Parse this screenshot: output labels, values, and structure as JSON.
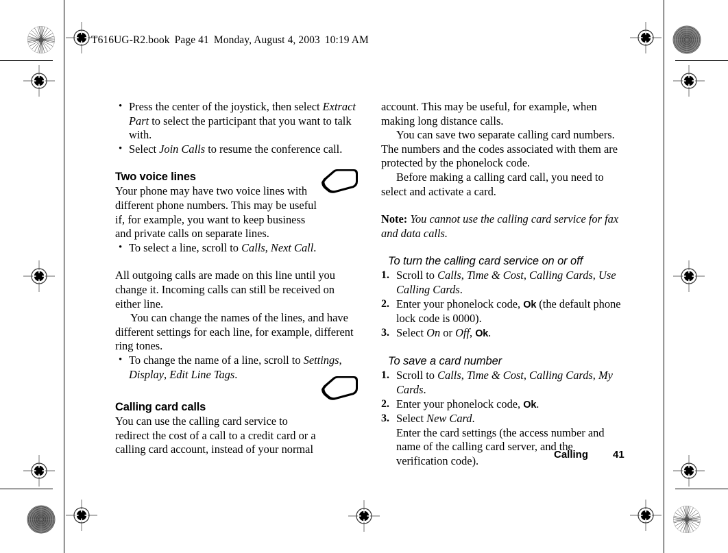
{
  "document": {
    "file_header": "T616UG-R2.book  Page 41  Monday, August 4, 2003  10:19 AM",
    "file_header_parts": {
      "filename": "T616UG-R2.book",
      "page_label": "Page 41",
      "date": "Monday, August 4, 2003",
      "time": "10:19 AM"
    },
    "footer": {
      "chapter": "Calling",
      "page_number": "41"
    }
  },
  "left_column": {
    "intro_bullets": [
      {
        "segments": [
          {
            "text": "Press the center of the joystick, then select ",
            "style": "roman"
          },
          {
            "text": "Extract Part",
            "style": "italic"
          },
          {
            "text": " to select the participant that you want to talk with.",
            "style": "roman"
          }
        ]
      },
      {
        "segments": [
          {
            "text": "Select ",
            "style": "roman"
          },
          {
            "text": "Join Calls",
            "style": "italic"
          },
          {
            "text": " to resume the conference call.",
            "style": "roman"
          }
        ]
      }
    ],
    "section_two_voice_lines": {
      "heading": "Two voice lines",
      "paragraph": "Your phone may have two voice lines with different phone numbers. This may be useful if, for example, you want to keep business and private calls on separate lines.",
      "bullet": {
        "segments": [
          {
            "text": "To select a line, scroll to ",
            "style": "roman"
          },
          {
            "text": "Calls",
            "style": "italic"
          },
          {
            "text": ", ",
            "style": "roman"
          },
          {
            "text": "Next Call",
            "style": "italic"
          },
          {
            "text": ".",
            "style": "roman"
          }
        ]
      },
      "paragraph_2": "All outgoing calls are made on this line until you change it. Incoming calls can still be received on either line.",
      "paragraph_3": "You can change the names of the lines, and have different settings for each line, for example, different ring tones.",
      "bullet_2": {
        "segments": [
          {
            "text": "To change the name of a line, scroll to ",
            "style": "roman"
          },
          {
            "text": "Settings",
            "style": "italic"
          },
          {
            "text": ", ",
            "style": "roman"
          },
          {
            "text": "Display",
            "style": "italic"
          },
          {
            "text": ", ",
            "style": "roman"
          },
          {
            "text": "Edit Line Tags",
            "style": "italic"
          },
          {
            "text": ".",
            "style": "roman"
          }
        ]
      }
    },
    "section_calling_card_calls": {
      "heading": "Calling card calls",
      "paragraph": "You can use the calling card service to redirect the cost of a call to a credit card or a calling card account, instead of your normal"
    }
  },
  "right_column": {
    "paragraph_continued": "account. This may be useful, for example, when making long distance calls.",
    "paragraph_2": "You can save two separate calling card numbers. The numbers and the codes associated with them are protected by the phonelock code.",
    "paragraph_3": "Before making a calling card call, you need to select and activate a card.",
    "note": {
      "label": "Note:",
      "text": "You cannot use the calling card service for fax and data calls."
    },
    "procedure_on_off": {
      "heading": "To turn the calling card service on or off",
      "steps": [
        {
          "number": "1.",
          "segments": [
            {
              "text": "Scroll to ",
              "style": "roman"
            },
            {
              "text": "Calls",
              "style": "italic"
            },
            {
              "text": ", ",
              "style": "roman"
            },
            {
              "text": "Time & Cost",
              "style": "italic"
            },
            {
              "text": ", ",
              "style": "roman"
            },
            {
              "text": "Calling Cards",
              "style": "italic"
            },
            {
              "text": ", ",
              "style": "roman"
            },
            {
              "text": "Use Calling Cards",
              "style": "italic"
            },
            {
              "text": ".",
              "style": "roman"
            }
          ]
        },
        {
          "number": "2.",
          "segments": [
            {
              "text": "Enter your phonelock code, ",
              "style": "roman"
            },
            {
              "text": "Ok",
              "style": "key"
            },
            {
              "text": " (the default phone lock code is 0000).",
              "style": "roman"
            }
          ]
        },
        {
          "number": "3.",
          "segments": [
            {
              "text": "Select ",
              "style": "roman"
            },
            {
              "text": "On",
              "style": "italic"
            },
            {
              "text": " or ",
              "style": "roman"
            },
            {
              "text": "Off",
              "style": "italic"
            },
            {
              "text": ", ",
              "style": "roman"
            },
            {
              "text": "Ok",
              "style": "key"
            },
            {
              "text": ".",
              "style": "roman"
            }
          ]
        }
      ]
    },
    "procedure_save_card": {
      "heading": "To save a card number",
      "steps": [
        {
          "number": "1.",
          "segments": [
            {
              "text": "Scroll to ",
              "style": "roman"
            },
            {
              "text": "Calls",
              "style": "italic"
            },
            {
              "text": ", ",
              "style": "roman"
            },
            {
              "text": "Time & Cost",
              "style": "italic"
            },
            {
              "text": ", ",
              "style": "roman"
            },
            {
              "text": "Calling Cards",
              "style": "italic"
            },
            {
              "text": ", ",
              "style": "roman"
            },
            {
              "text": "My Cards",
              "style": "italic"
            },
            {
              "text": ".",
              "style": "roman"
            }
          ]
        },
        {
          "number": "2.",
          "segments": [
            {
              "text": "Enter your phonelock code, ",
              "style": "roman"
            },
            {
              "text": "Ok",
              "style": "key"
            },
            {
              "text": ".",
              "style": "roman"
            }
          ]
        },
        {
          "number": "3.",
          "segments": [
            {
              "text": "Select ",
              "style": "roman"
            },
            {
              "text": "New Card",
              "style": "italic"
            },
            {
              "text": ".",
              "style": "roman"
            }
          ]
        }
      ],
      "trailing_text": "Enter the card settings (the access number and name of the calling card server, and the verification code)."
    }
  },
  "print_marks": {
    "icon_names": [
      "registration-target-icon",
      "star-rosette-icon",
      "crop-rule"
    ],
    "note_icon_name": "phone-note-icon"
  },
  "colors": {
    "ink": "#000000",
    "paper": "#ffffff",
    "mark_gray": "#9a9a9a"
  }
}
